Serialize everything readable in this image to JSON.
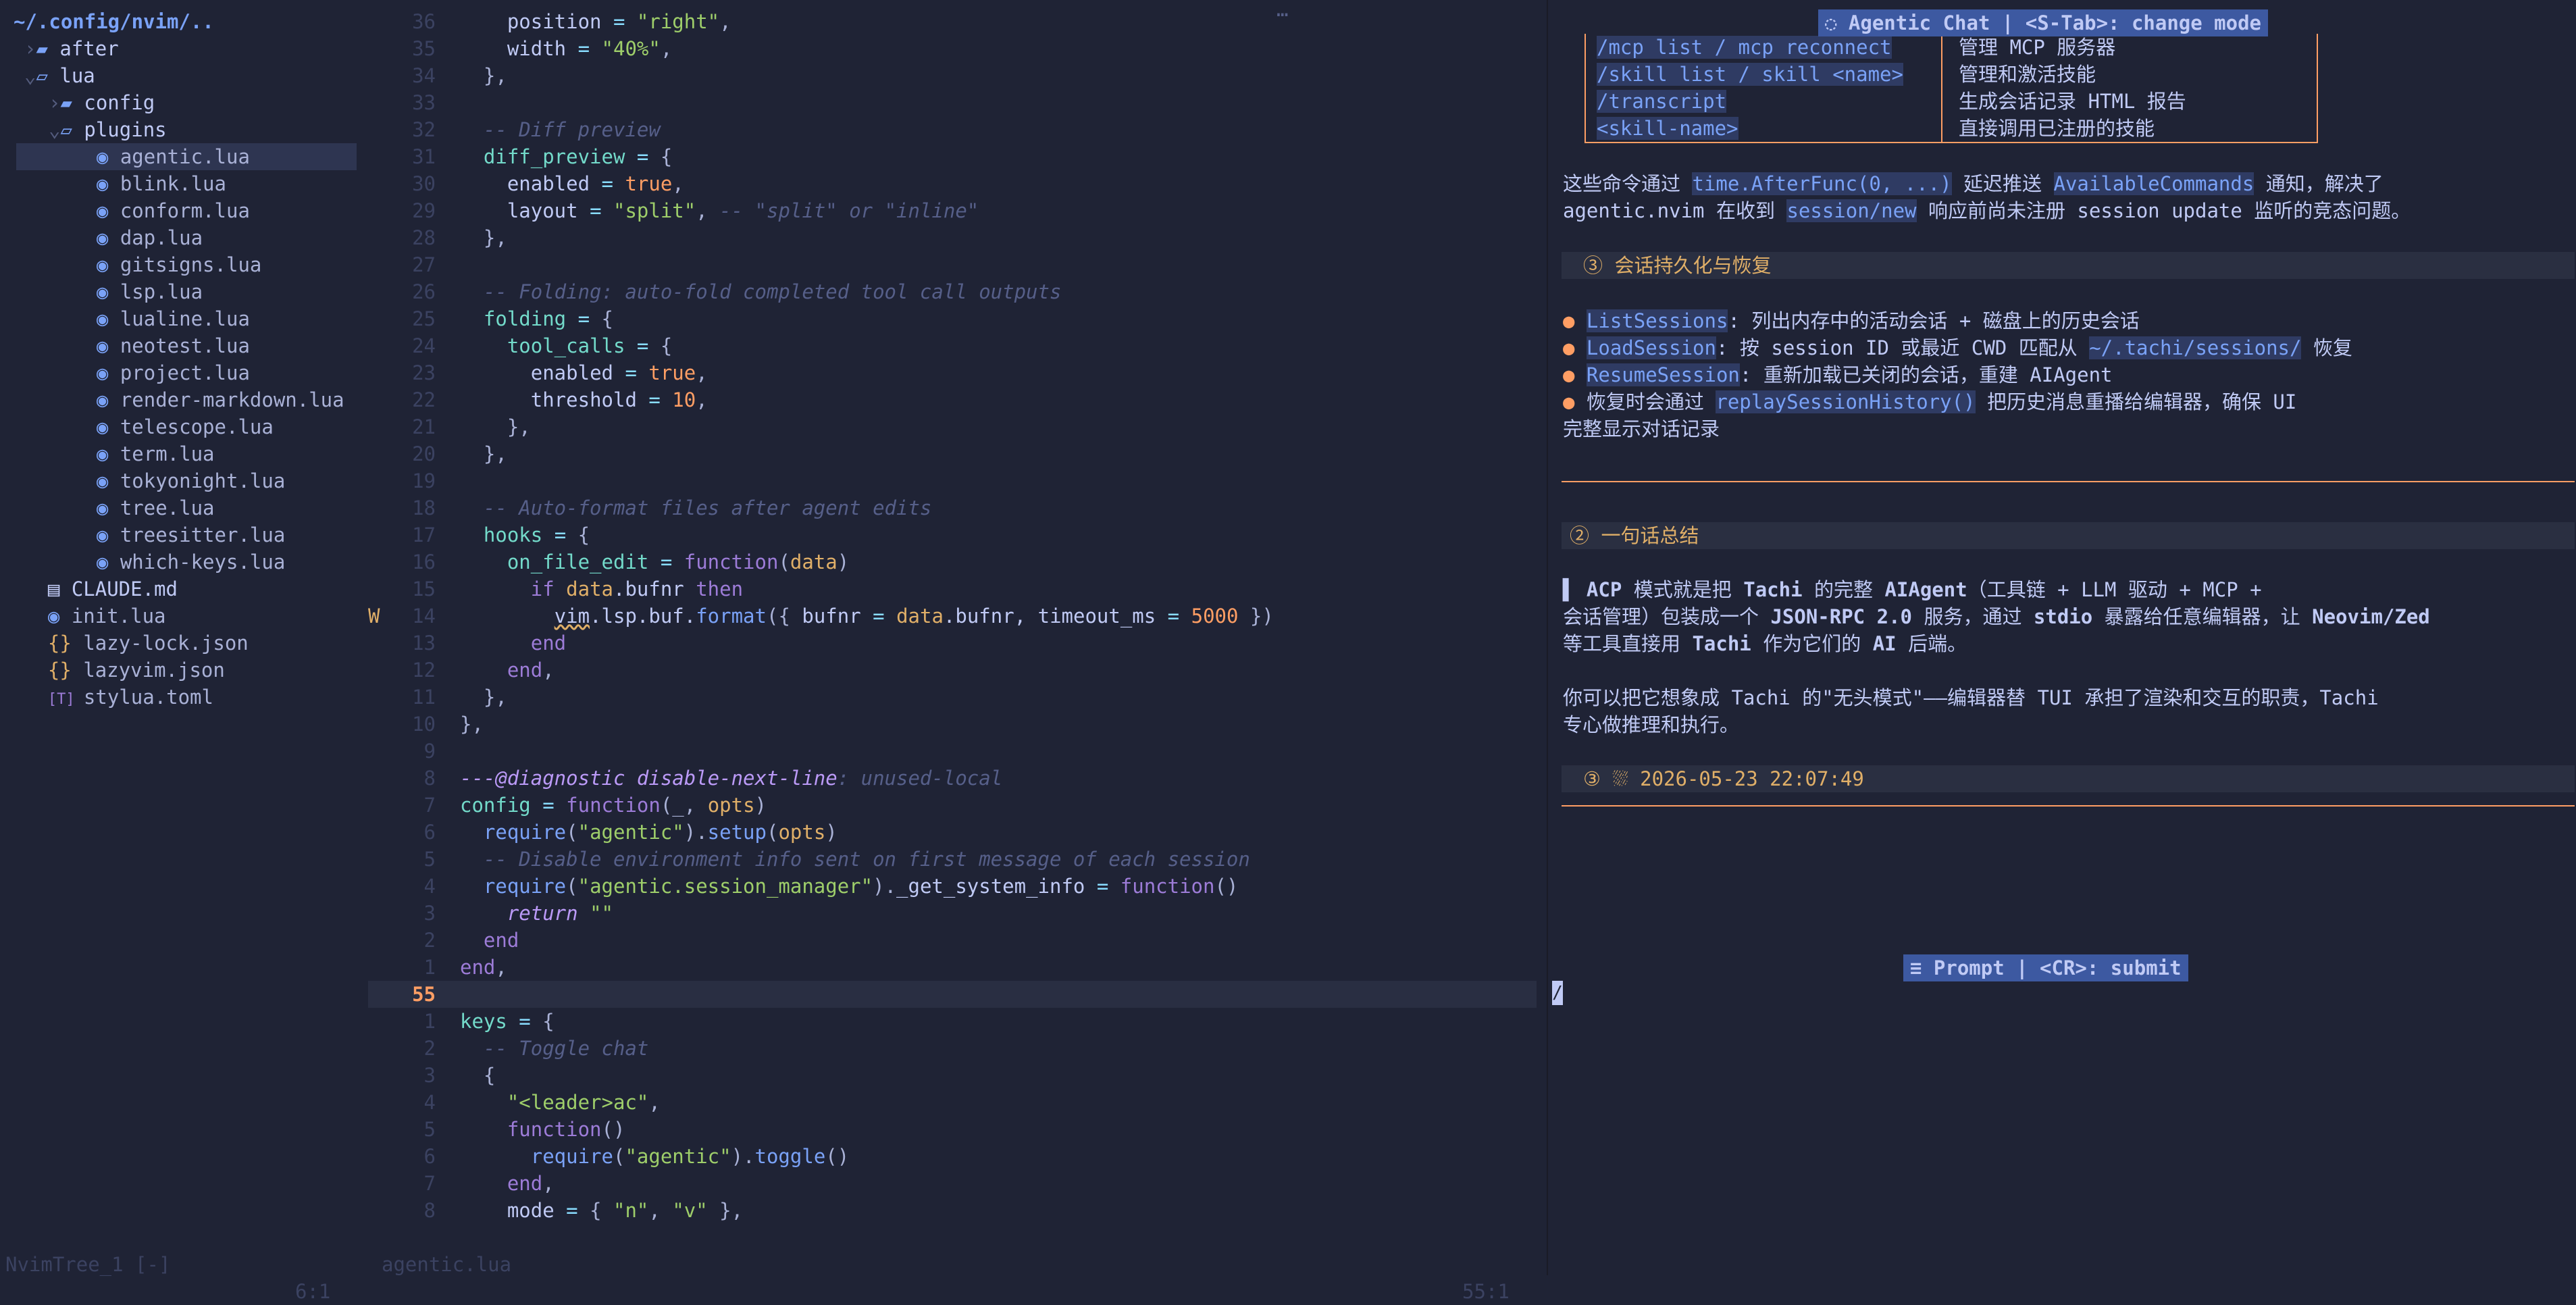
{
  "tree": {
    "root": "~/.config/nvim/..",
    "items": [
      {
        "chev": "›",
        "icon": "folder",
        "label": "after",
        "indent": 1,
        "type": "dir"
      },
      {
        "chev": "⌄",
        "icon": "folder-open",
        "label": "lua",
        "indent": 1,
        "type": "dir"
      },
      {
        "chev": "›",
        "icon": "folder",
        "label": "config",
        "indent": 2,
        "type": "dir"
      },
      {
        "chev": "⌄",
        "icon": "folder-open",
        "label": "plugins",
        "indent": 2,
        "type": "dir"
      },
      {
        "icon": "lua",
        "label": "agentic.lua",
        "indent": 3,
        "type": "file",
        "selected": true
      },
      {
        "icon": "lua",
        "label": "blink.lua",
        "indent": 3,
        "type": "file"
      },
      {
        "icon": "lua",
        "label": "conform.lua",
        "indent": 3,
        "type": "file"
      },
      {
        "icon": "lua",
        "label": "dap.lua",
        "indent": 3,
        "type": "file"
      },
      {
        "icon": "lua",
        "label": "gitsigns.lua",
        "indent": 3,
        "type": "file"
      },
      {
        "icon": "lua",
        "label": "lsp.lua",
        "indent": 3,
        "type": "file"
      },
      {
        "icon": "lua",
        "label": "lualine.lua",
        "indent": 3,
        "type": "file"
      },
      {
        "icon": "lua",
        "label": "neotest.lua",
        "indent": 3,
        "type": "file"
      },
      {
        "icon": "lua",
        "label": "project.lua",
        "indent": 3,
        "type": "file"
      },
      {
        "icon": "lua",
        "label": "render-markdown.lua",
        "indent": 3,
        "type": "file"
      },
      {
        "icon": "lua",
        "label": "telescope.lua",
        "indent": 3,
        "type": "file"
      },
      {
        "icon": "lua",
        "label": "term.lua",
        "indent": 3,
        "type": "file"
      },
      {
        "icon": "lua",
        "label": "tokyonight.lua",
        "indent": 3,
        "type": "file"
      },
      {
        "icon": "lua",
        "label": "tree.lua",
        "indent": 3,
        "type": "file"
      },
      {
        "icon": "lua",
        "label": "treesitter.lua",
        "indent": 3,
        "type": "file"
      },
      {
        "icon": "lua",
        "label": "which-keys.lua",
        "indent": 3,
        "type": "file"
      },
      {
        "icon": "md",
        "label": "CLAUDE.md",
        "indent": 1,
        "type": "file-md"
      },
      {
        "icon": "lua",
        "label": "init.lua",
        "indent": 1,
        "type": "file"
      },
      {
        "icon": "json",
        "label": "lazy-lock.json",
        "indent": 1,
        "type": "file"
      },
      {
        "icon": "json",
        "label": "lazyvim.json",
        "indent": 1,
        "type": "file"
      },
      {
        "icon": "toml",
        "label": "stylua.toml",
        "indent": 1,
        "type": "file"
      }
    ],
    "icons": {
      "folder": "▰",
      "folder-open": "▱",
      "lua": "◉",
      "md": "▤",
      "json": "{}",
      "toml": "[T]"
    }
  },
  "editor": {
    "top_marker": "…",
    "current_line": "55",
    "lines": [
      {
        "n": "36",
        "t": [
          [
            "    ",
            "plain"
          ],
          [
            "position",
            "fld"
          ],
          [
            " = ",
            "op"
          ],
          [
            "\"right\"",
            "str"
          ],
          [
            ",",
            "punc"
          ]
        ]
      },
      {
        "n": "35",
        "t": [
          [
            "    ",
            "plain"
          ],
          [
            "width",
            "fld"
          ],
          [
            " = ",
            "op"
          ],
          [
            "\"40%\"",
            "str"
          ],
          [
            ",",
            "punc"
          ]
        ]
      },
      {
        "n": "34",
        "t": [
          [
            "  ",
            "plain"
          ],
          [
            "},",
            "punc"
          ]
        ]
      },
      {
        "n": "33",
        "t": []
      },
      {
        "n": "32",
        "t": [
          [
            "  ",
            "plain"
          ],
          [
            "-- Diff preview",
            "cmt"
          ]
        ]
      },
      {
        "n": "31",
        "t": [
          [
            "  ",
            "plain"
          ],
          [
            "diff_preview",
            "prop"
          ],
          [
            " = ",
            "op"
          ],
          [
            "{",
            "punc"
          ]
        ]
      },
      {
        "n": "30",
        "t": [
          [
            "    ",
            "plain"
          ],
          [
            "enabled",
            "fld"
          ],
          [
            " = ",
            "op"
          ],
          [
            "true",
            "bool"
          ],
          [
            ",",
            "punc"
          ]
        ]
      },
      {
        "n": "29",
        "t": [
          [
            "    ",
            "plain"
          ],
          [
            "layout",
            "fld"
          ],
          [
            " = ",
            "op"
          ],
          [
            "\"split\"",
            "str"
          ],
          [
            ", ",
            "punc"
          ],
          [
            "-- \"split\" or \"inline\"",
            "cmt"
          ]
        ]
      },
      {
        "n": "28",
        "t": [
          [
            "  ",
            "plain"
          ],
          [
            "},",
            "punc"
          ]
        ]
      },
      {
        "n": "27",
        "t": []
      },
      {
        "n": "26",
        "t": [
          [
            "  ",
            "plain"
          ],
          [
            "-- Folding: auto-fold completed tool call outputs",
            "cmt"
          ]
        ]
      },
      {
        "n": "25",
        "t": [
          [
            "  ",
            "plain"
          ],
          [
            "folding",
            "prop"
          ],
          [
            " = ",
            "op"
          ],
          [
            "{",
            "punc"
          ]
        ]
      },
      {
        "n": "24",
        "t": [
          [
            "    ",
            "plain"
          ],
          [
            "tool_calls",
            "prop"
          ],
          [
            " = ",
            "op"
          ],
          [
            "{",
            "punc"
          ]
        ]
      },
      {
        "n": "23",
        "t": [
          [
            "      ",
            "plain"
          ],
          [
            "enabled",
            "fld"
          ],
          [
            " = ",
            "op"
          ],
          [
            "true",
            "bool"
          ],
          [
            ",",
            "punc"
          ]
        ]
      },
      {
        "n": "22",
        "t": [
          [
            "      ",
            "plain"
          ],
          [
            "threshold",
            "fld"
          ],
          [
            " = ",
            "op"
          ],
          [
            "10",
            "num"
          ],
          [
            ",",
            "punc"
          ]
        ]
      },
      {
        "n": "21",
        "t": [
          [
            "    ",
            "plain"
          ],
          [
            "},",
            "punc"
          ]
        ]
      },
      {
        "n": "20",
        "t": [
          [
            "  ",
            "plain"
          ],
          [
            "},",
            "punc"
          ]
        ]
      },
      {
        "n": "19",
        "t": []
      },
      {
        "n": "18",
        "t": [
          [
            "  ",
            "plain"
          ],
          [
            "-- Auto-format files after agent edits",
            "cmt"
          ]
        ]
      },
      {
        "n": "17",
        "t": [
          [
            "  ",
            "plain"
          ],
          [
            "hooks",
            "prop"
          ],
          [
            " = ",
            "op"
          ],
          [
            "{",
            "punc"
          ]
        ]
      },
      {
        "n": "16",
        "t": [
          [
            "    ",
            "plain"
          ],
          [
            "on_file_edit",
            "prop"
          ],
          [
            " = ",
            "op"
          ],
          [
            "function",
            "kw"
          ],
          [
            "(",
            "punc"
          ],
          [
            "data",
            "var"
          ],
          [
            ")",
            "punc"
          ]
        ]
      },
      {
        "n": "15",
        "t": [
          [
            "      ",
            "plain"
          ],
          [
            "if ",
            "kw"
          ],
          [
            "data",
            "var"
          ],
          [
            ".bufnr ",
            "plain"
          ],
          [
            "then",
            "kw"
          ]
        ]
      },
      {
        "n": "14",
        "sign": "W",
        "t": [
          [
            "        ",
            "plain"
          ],
          [
            "vim",
            "warnu"
          ],
          [
            ".lsp.buf.",
            "plain"
          ],
          [
            "format",
            "fn"
          ],
          [
            "({ ",
            "punc"
          ],
          [
            "bufnr",
            "fld"
          ],
          [
            " = ",
            "op"
          ],
          [
            "data",
            "var"
          ],
          [
            ".bufnr, ",
            "plain"
          ],
          [
            "timeout_ms",
            "fld"
          ],
          [
            " = ",
            "op"
          ],
          [
            "5000",
            "num"
          ],
          [
            " })",
            "punc"
          ]
        ]
      },
      {
        "n": "13",
        "t": [
          [
            "      ",
            "plain"
          ],
          [
            "end",
            "kw"
          ]
        ]
      },
      {
        "n": "12",
        "t": [
          [
            "    ",
            "plain"
          ],
          [
            "end",
            "kw"
          ],
          [
            ",",
            "punc"
          ]
        ]
      },
      {
        "n": "11",
        "t": [
          [
            "  ",
            "plain"
          ],
          [
            "},",
            "punc"
          ]
        ]
      },
      {
        "n": "10",
        "t": [
          [
            "",
            "plain"
          ],
          [
            "},",
            "punc"
          ]
        ]
      },
      {
        "n": "9",
        "t": []
      },
      {
        "n": "8",
        "t": [
          [
            "",
            "plain"
          ],
          [
            "---@diagnostic ",
            "kwi"
          ],
          [
            "disable-next-line",
            "kwi"
          ],
          [
            ": unused-local",
            "cmt"
          ]
        ]
      },
      {
        "n": "7",
        "t": [
          [
            "",
            "plain"
          ],
          [
            "config",
            "prop"
          ],
          [
            " = ",
            "op"
          ],
          [
            "function",
            "kw"
          ],
          [
            "(_, ",
            "punc"
          ],
          [
            "opts",
            "var"
          ],
          [
            ")",
            "punc"
          ]
        ]
      },
      {
        "n": "6",
        "t": [
          [
            "  ",
            "plain"
          ],
          [
            "require",
            "fn"
          ],
          [
            "(",
            "punc"
          ],
          [
            "\"agentic\"",
            "str"
          ],
          [
            ").",
            "punc"
          ],
          [
            "setup",
            "fn"
          ],
          [
            "(",
            "punc"
          ],
          [
            "opts",
            "var"
          ],
          [
            ")",
            "punc"
          ]
        ]
      },
      {
        "n": "5",
        "t": [
          [
            "  ",
            "plain"
          ],
          [
            "-- Disable environment info sent on first message of each session",
            "cmt"
          ]
        ]
      },
      {
        "n": "4",
        "t": [
          [
            "  ",
            "plain"
          ],
          [
            "require",
            "fn"
          ],
          [
            "(",
            "punc"
          ],
          [
            "\"agentic.session_manager\"",
            "str"
          ],
          [
            ").",
            "punc"
          ],
          [
            "_get_system_info",
            "plain"
          ],
          [
            " = ",
            "op"
          ],
          [
            "function",
            "kw"
          ],
          [
            "()",
            "punc"
          ]
        ]
      },
      {
        "n": "3",
        "t": [
          [
            "    ",
            "plain"
          ],
          [
            "return ",
            "kwi"
          ],
          [
            "\"\"",
            "str"
          ]
        ]
      },
      {
        "n": "2",
        "t": [
          [
            "  ",
            "plain"
          ],
          [
            "end",
            "kw"
          ]
        ]
      },
      {
        "n": "1",
        "t": [
          [
            "",
            "plain"
          ],
          [
            "end",
            "kw"
          ],
          [
            ",",
            "punc"
          ]
        ]
      },
      {
        "n": "55",
        "cur": true,
        "t": []
      },
      {
        "n": "1",
        "t": [
          [
            "",
            "plain"
          ],
          [
            "keys",
            "prop"
          ],
          [
            " = ",
            "op"
          ],
          [
            "{",
            "punc"
          ]
        ]
      },
      {
        "n": "2",
        "t": [
          [
            "  ",
            "plain"
          ],
          [
            "-- Toggle chat",
            "cmt"
          ]
        ]
      },
      {
        "n": "3",
        "t": [
          [
            "  ",
            "plain"
          ],
          [
            "{",
            "punc"
          ]
        ]
      },
      {
        "n": "4",
        "t": [
          [
            "    ",
            "plain"
          ],
          [
            "\"<leader>ac\"",
            "str"
          ],
          [
            ",",
            "punc"
          ]
        ]
      },
      {
        "n": "5",
        "t": [
          [
            "    ",
            "plain"
          ],
          [
            "function",
            "kw"
          ],
          [
            "()",
            "punc"
          ]
        ]
      },
      {
        "n": "6",
        "t": [
          [
            "      ",
            "plain"
          ],
          [
            "require",
            "fn"
          ],
          [
            "(",
            "punc"
          ],
          [
            "\"agentic\"",
            "str"
          ],
          [
            ").",
            "punc"
          ],
          [
            "toggle",
            "fn"
          ],
          [
            "()",
            "punc"
          ]
        ]
      },
      {
        "n": "7",
        "t": [
          [
            "    ",
            "plain"
          ],
          [
            "end",
            "kw"
          ],
          [
            ",",
            "punc"
          ]
        ]
      },
      {
        "n": "8",
        "t": [
          [
            "    ",
            "plain"
          ],
          [
            "mode",
            "fld"
          ],
          [
            " = ",
            "op"
          ],
          [
            "{ ",
            "punc"
          ],
          [
            "\"n\"",
            "str"
          ],
          [
            ", ",
            "punc"
          ],
          [
            "\"v\"",
            "str"
          ],
          [
            " },",
            "punc"
          ]
        ]
      }
    ]
  },
  "chat": {
    "title": "◌ Agentic Chat | <S-Tab>: change mode",
    "commands": [
      {
        "cmd": "/mcp list / mcp reconnect",
        "desc": "管理 MCP 服务器"
      },
      {
        "cmd": "/skill list / skill <name>",
        "desc": "管理和激活技能"
      },
      {
        "cmd": "/transcript",
        "desc": "生成会话记录 HTML 报告"
      },
      {
        "cmd": "<skill-name>",
        "desc": "直接调用已注册的技能"
      }
    ],
    "para1": {
      "p1": "这些命令通过 ",
      "c1": "time.AfterFunc(0, ...)",
      "p2": " 延迟推送 ",
      "c2": "AvailableCommands",
      "p3": " 通知，解决了",
      "p4": "agentic.nvim 在收到 ",
      "c3": "session/new",
      "p5": " 响应前尚未注册 session update 监听的竞态问题。"
    },
    "section3_title": "③  会话持久化与恢复",
    "bullets": [
      {
        "code": "ListSessions",
        "text": ": 列出内存中的活动会话 + 磁盘上的历史会话"
      },
      {
        "code": "LoadSession",
        "text": ": 按 session ID 或最近 CWD 匹配从 ",
        "code2": "~/.tachi/sessions/",
        "text2": " 恢复"
      },
      {
        "code": "ResumeSession",
        "text": ": 重新加载已关闭的会话，重建 AIAgent"
      },
      {
        "pre": "恢复时会通过 ",
        "code": "replaySessionHistory()",
        "text": " 把历史消息重播给编辑器，确保 UI"
      }
    ],
    "bullet_cont": "完整显示对话记录",
    "summary_title": "② 一句话总结",
    "quote": {
      "l1a": "▌ ",
      "l1b": "ACP",
      "l1c": " 模式就是把 ",
      "l1d": "Tachi",
      "l1e": " 的完整 ",
      "l1f": "AIAgent",
      "l1g": "（工具链 + LLM 驱动 + MCP +",
      "l2a": "会话管理）包装成一个 ",
      "l2b": "JSON-RPC 2.0",
      "l2c": " 服务，通过 ",
      "l2d": "stdio",
      "l2e": " 暴露给任意编辑器，让 ",
      "l2f": "Neovim/Zed",
      "l3a": "等工具直接用 ",
      "l3b": "Tachi",
      "l3c": " 作为它们的 ",
      "l3d": "AI",
      "l3e": " 后端。"
    },
    "para2": [
      "你可以把它想象成 Tachi 的\"无头模式\"——编辑器替 TUI 承担了渲染和交互的职责，Tachi",
      "专心做推理和执行。"
    ],
    "timestamp": "③ ⛆ 2026-05-23 22:07:49",
    "prompt_title": "≡ Prompt | <CR>: submit",
    "cursor_char": "/"
  },
  "status": {
    "tree_left": "NvimTree_1 [-]",
    "tree_right": "6:1",
    "editor_left": "agentic.lua",
    "editor_right": "55:1"
  },
  "colors": {
    "accent": "#3d59a1",
    "warning": "#e0af68",
    "border": "#ff9e64",
    "background": "#1f2335"
  }
}
